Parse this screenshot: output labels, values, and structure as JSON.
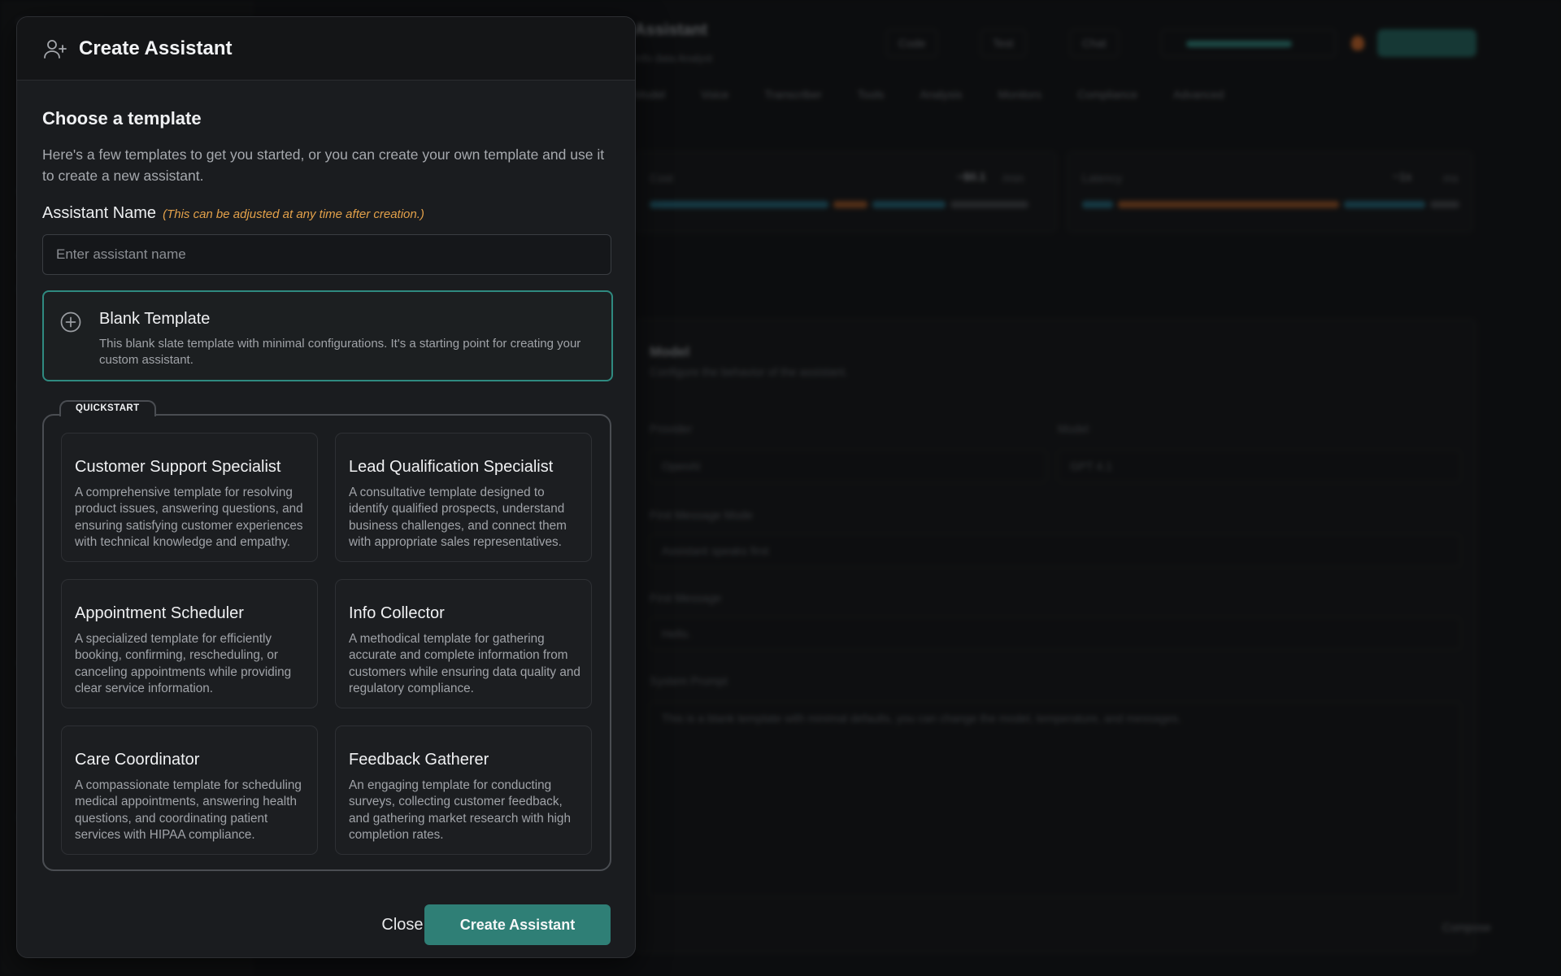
{
  "background": {
    "title": "Assistant",
    "subtitle": "Info data Analyst",
    "top_buttons": [
      "Code",
      "Test",
      "Chat"
    ],
    "tabs": [
      "Model",
      "Voice",
      "Transcriber",
      "Tools",
      "Analysis",
      "Monitors",
      "Compliance",
      "Advanced"
    ],
    "cost_label": "Cost",
    "cost_value": "~$0.1",
    "cost_unit": "/min",
    "latency_label": "Latency",
    "latency_value": "~1s",
    "latency_unit": "ms",
    "section_title": "Model",
    "section_desc": "Configure the behavior of the assistant.",
    "provider_label": "Provider",
    "provider_value": "OpenAI",
    "model_label": "Model",
    "model_value": "GPT 4.1",
    "first_message_mode_label": "First Message Mode",
    "first_message_mode_value": "Assistant speaks first",
    "first_message_label": "First Message",
    "first_message_value": "Hello.",
    "system_prompt_label": "System Prompt",
    "system_prompt_value": "This is a blank template with minimal defaults, you can change the model, temperature, and messages.",
    "compose_label": "Compose"
  },
  "modal": {
    "title": "Create Assistant",
    "header_icon": "user-plus-icon",
    "choose_title": "Choose a template",
    "choose_desc": "Here's a few templates to get you started, or you can create your own template and use it to create a new assistant.",
    "name_label": "Assistant Name",
    "name_hint": "(This can be adjusted at any time after creation.)",
    "name_value": "",
    "name_placeholder": "Enter assistant name",
    "blank": {
      "title": "Blank Template",
      "desc": "This blank slate template with minimal configurations. It's a starting point for creating your custom assistant.",
      "icon": "plus-circle-icon"
    },
    "quickstart_label": "QUICKSTART",
    "templates": [
      {
        "title": "Customer Support Specialist",
        "desc": "A comprehensive template for resolving product issues, answering questions, and ensuring satisfying customer experiences with technical knowledge and empathy."
      },
      {
        "title": "Lead Qualification Specialist",
        "desc": "A consultative template designed to identify qualified prospects, understand business challenges, and connect them with appropriate sales representatives."
      },
      {
        "title": "Appointment Scheduler",
        "desc": "A specialized template for efficiently booking, confirming, rescheduling, or canceling appointments while providing clear service information."
      },
      {
        "title": "Info Collector",
        "desc": "A methodical template for gathering accurate and complete information from customers while ensuring data quality and regulatory compliance."
      },
      {
        "title": "Care Coordinator",
        "desc": "A compassionate template for scheduling medical appointments, answering health questions, and coordinating patient services with HIPAA compliance."
      },
      {
        "title": "Feedback Gatherer",
        "desc": "An engaging template for conducting surveys, collecting customer feedback, and gathering market research with high completion rates."
      }
    ],
    "close_label": "Close",
    "create_label": "Create Assistant"
  },
  "colors": {
    "accent": "#2f7f76",
    "accent_border": "#2f8a80",
    "hint": "#e3a14a",
    "modal_bg": "#1a1c1f"
  }
}
